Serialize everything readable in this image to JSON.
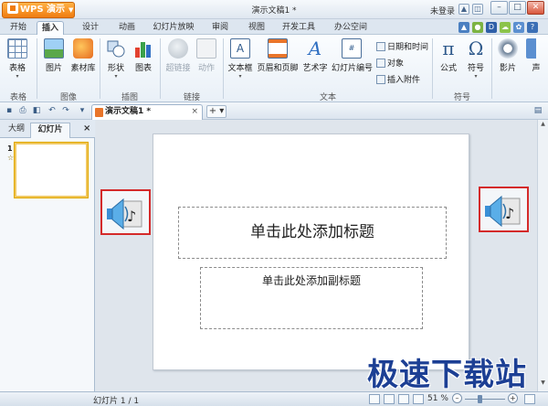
{
  "window": {
    "app_menu_label": "WPS 演示",
    "title": "演示文稿1 *",
    "login_text": "未登录",
    "min_label": "–",
    "max_label": "□",
    "close_label": "✕"
  },
  "tabs": [
    {
      "label": "开始"
    },
    {
      "label": "插入"
    },
    {
      "label": "设计"
    },
    {
      "label": "动画"
    },
    {
      "label": "幻灯片放映"
    },
    {
      "label": "审阅"
    },
    {
      "label": "视图"
    },
    {
      "label": "开发工具"
    },
    {
      "label": "办公空间"
    }
  ],
  "active_tab": "插入",
  "ribbon": {
    "items": {
      "table": "表格",
      "picture": "图片",
      "material": "素材库",
      "shape": "形状",
      "chart": "图表",
      "hyperlink": "超链接",
      "action": "动作",
      "textbox": "文本框",
      "header_footer": "页眉和页脚",
      "wordart": "艺术字",
      "slide_number": "幻灯片编号",
      "datetime": "日期和时间",
      "object": "对象",
      "attachment": "插入附件",
      "formula": "公式",
      "symbol": "符号",
      "movie": "影片",
      "sound": "声"
    },
    "groups": {
      "table": "表格",
      "image": "图像",
      "illustration": "插图",
      "link": "链接",
      "text": "文本",
      "symbol": "符号"
    }
  },
  "doc_tab": {
    "label": "演示文稿1 *",
    "close": "×",
    "new_tab": "+ ▾"
  },
  "left_panel": {
    "tabs": [
      "大纲",
      "幻灯片"
    ],
    "close": "×",
    "slide_number": "1",
    "slide_star": "☆"
  },
  "slide": {
    "title_placeholder": "单击此处添加标题",
    "subtitle_placeholder": "单击此处添加副标题"
  },
  "status": {
    "slide_info": "幻灯片 1 / 1",
    "zoom": "51 %"
  },
  "watermark": "极速下载站",
  "colors": {
    "accent_orange": "#f07c10",
    "highlight_red": "#d42a2a",
    "watermark_blue": "#1c3f94"
  }
}
